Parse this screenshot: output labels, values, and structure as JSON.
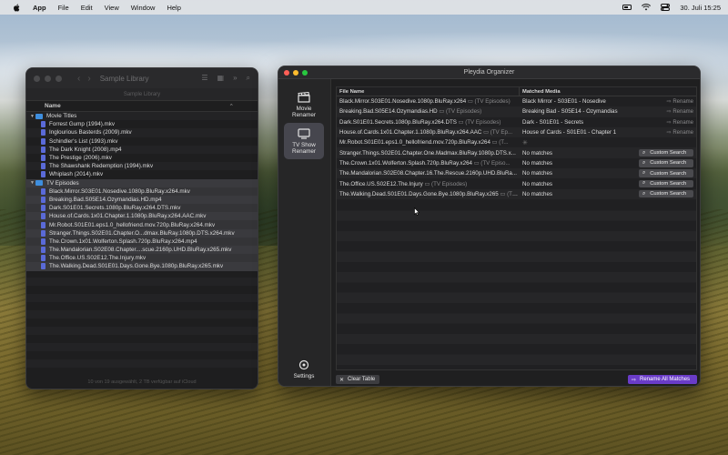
{
  "menubar": {
    "app": "App",
    "items": [
      "File",
      "Edit",
      "View",
      "Window",
      "Help"
    ],
    "clock": "30. Juli  15:25"
  },
  "finder": {
    "title": "Sample Library",
    "path": "Sample Library",
    "column_name": "Name",
    "status": "10 von 19 ausgewählt, 2 TB verfügbar auf iCloud",
    "folders": [
      {
        "name": "Movie Titles",
        "files": [
          "Forrest Gump (1994).mkv",
          "Inglourious Basterds (2009).mkv",
          "Schindler's List (1993).mkv",
          "The Dark Knight (2008).mp4",
          "The Prestige (2006).mkv",
          "The Shawshank Redemption (1994).mkv",
          "Whiplash (2014).mkv"
        ]
      },
      {
        "name": "TV Episodes",
        "files": [
          "Black.Mirror.S03E01.Nosedive.1080p.BluRay.x264.mkv",
          "Breaking.Bad.S05E14.Ozymandias.HD.mp4",
          "Dark.S01E01.Secrets.1080p.BluRay.x264.DTS.mkv",
          "House.of.Cards.1x01.Chapter.1.1080p.BluRay.x264.AAC.mkv",
          "Mr.Robot.S01E01.eps1.0_hellofriend.mov.720p.BluRay.x264.mkv",
          "Stranger.Things.S02E01.Chapter.O...dmax.BluRay.1080p.DTS.x264.mkv",
          "The.Crown.1x01.Wolferton.Splash.720p.BluRay.x264.mp4",
          "The.Mandalorian.S02E08.Chapter....scue.2160p.UHD.BluRay.x265.mkv",
          "The.Office.US.S02E12.The.Injury.mkv",
          "The.Walking.Dead.S01E01.Days.Gone.Bye.1080p.BluRay.x265.mkv"
        ]
      }
    ]
  },
  "pleydia": {
    "title": "Pleydia Organizer",
    "sidebar": {
      "movie_renamer": "Movie Renamer",
      "tv_show_renamer": "TV Show Renamer",
      "settings": "Settings"
    },
    "columns": {
      "file_name": "File Name",
      "matched_media": "Matched Media"
    },
    "rows": [
      {
        "file": "Black.Mirror.S03E01.Nosedive.1080p.BluRay.x264",
        "type": "(TV Episodes)",
        "match": "Black Mirror - S03E01 - Nosedive",
        "action": "Rename"
      },
      {
        "file": "Breaking.Bad.S05E14.Ozymandias.HD",
        "type": "(TV Episodes)",
        "match": "Breaking Bad - S05E14 - Ozymandias",
        "action": "Rename"
      },
      {
        "file": "Dark.S01E01.Secrets.1080p.BluRay.x264.DTS",
        "type": "(TV Episodes)",
        "match": "Dark - S01E01 - Secrets",
        "action": "Rename"
      },
      {
        "file": "House.of.Cards.1x01.Chapter.1.1080p.BluRay.x264.AAC",
        "type": "(TV Ep...",
        "match": "House of Cards - S01E01 - Chapter 1",
        "action": "Rename"
      },
      {
        "file": "Mr.Robot.S01E01.eps1.0_hellofriend.mov.720p.BluRay.x264",
        "type": "(T...",
        "match": "",
        "action": ""
      },
      {
        "file": "Stranger.Things.S02E01.Chapter.One.Madmax.BluRay.1080p.DTS.x...",
        "type": "",
        "match": "No matches",
        "action": "Custom Search"
      },
      {
        "file": "The.Crown.1x01.Wolferton.Splash.720p.BluRay.x264",
        "type": "(TV Episo...",
        "match": "No matches",
        "action": "Custom Search"
      },
      {
        "file": "The.Mandalorian.S02E08.Chapter.16.The.Rescue.2160p.UHD.BluRa...",
        "type": "",
        "match": "No matches",
        "action": "Custom Search"
      },
      {
        "file": "The.Office.US.S02E12.The.Injury",
        "type": "(TV Episodes)",
        "match": "No matches",
        "action": "Custom Search"
      },
      {
        "file": "The.Walking.Dead.S01E01.Days.Gone.Bye.1080p.BluRay.x265",
        "type": "(TV...",
        "match": "No matches",
        "action": "Custom Search"
      }
    ],
    "buttons": {
      "clear": "Clear Table",
      "rename_all": "Rename All Matches"
    }
  },
  "colors": {
    "accent": "#6a3cc8",
    "folder": "#3e8ede"
  }
}
